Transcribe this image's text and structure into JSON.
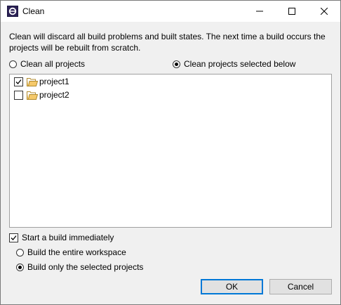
{
  "window": {
    "title": "Clean"
  },
  "description": "Clean will discard all build problems and built states.  The next time a build occurs the projects will be rebuilt from scratch.",
  "scope": {
    "clean_all_label": "Clean all projects",
    "clean_selected_label": "Clean projects selected below",
    "selected": "clean_selected"
  },
  "projects": [
    {
      "name": "project1",
      "checked": true
    },
    {
      "name": "project2",
      "checked": false
    }
  ],
  "build": {
    "start_build_label": "Start a build immediately",
    "start_build_checked": true,
    "entire_workspace_label": "Build the entire workspace",
    "selected_projects_label": "Build only the selected projects",
    "selected": "selected_projects"
  },
  "buttons": {
    "ok": "OK",
    "cancel": "Cancel"
  },
  "colors": {
    "default_button_border": "#0078d7",
    "folder_fill": "#f5c96a"
  }
}
